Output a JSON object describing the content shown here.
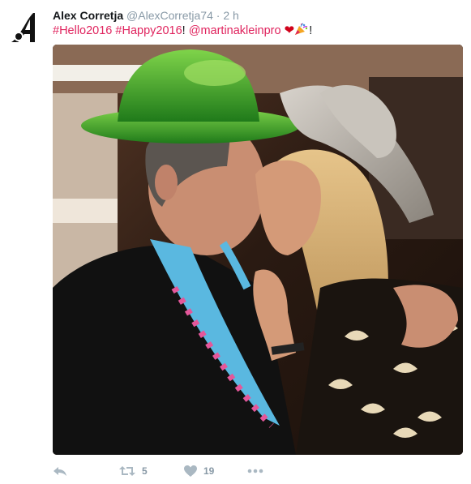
{
  "tweet": {
    "author_name": "Alex Corretja",
    "author_handle": "@AlexCorretja74",
    "separator": "·",
    "time": "2 h",
    "avatar_icon": "letter-a-logo-icon",
    "text": {
      "hashtag1": "#Hello2016",
      "hashtag2": "#Happy2016",
      "exclaim": "!",
      "mention": "@martinakleinpro",
      "heart_emoji": "❤",
      "party_emoji_icon": "party-popper-icon",
      "end": "!"
    },
    "link_color": "#e0245e",
    "photo_icon": "photo-couple-kissing-in-party-hats"
  },
  "actions": {
    "reply_icon": "reply-icon",
    "retweet_icon": "retweet-icon",
    "retweet_count": "5",
    "like_icon": "heart-icon",
    "like_count": "19",
    "more_icon": "more-dots-icon"
  }
}
